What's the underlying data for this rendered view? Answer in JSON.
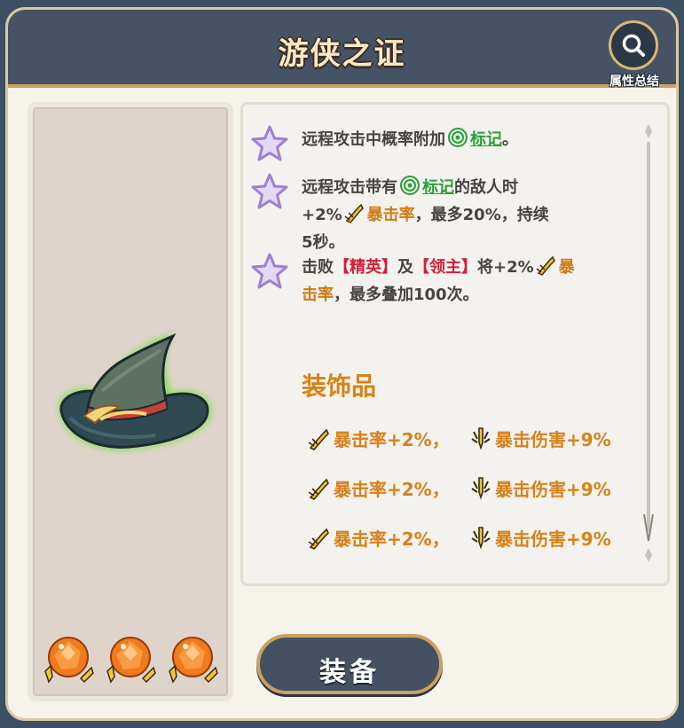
{
  "header": {
    "title": "游侠之证",
    "summary_label": "属性总结"
  },
  "effects": [
    {
      "parts": [
        {
          "t": "远程攻击中概率附加",
          "c": "plain"
        },
        {
          "icon": "target-icon"
        },
        {
          "t": "标记",
          "c": "green"
        },
        {
          "t": "。",
          "c": "plain"
        }
      ]
    },
    {
      "parts": [
        {
          "t": "远程攻击带有",
          "c": "plain"
        },
        {
          "icon": "target-icon"
        },
        {
          "t": "标记",
          "c": "green"
        },
        {
          "t": "的敌人时",
          "c": "plain"
        },
        {
          "br": true
        },
        {
          "t": "+2%",
          "c": "plain"
        },
        {
          "icon": "crit-rate-icon"
        },
        {
          "t": "暴击率",
          "c": "gold"
        },
        {
          "t": "，最多20%，持续",
          "c": "plain"
        },
        {
          "br": true
        },
        {
          "t": "5秒。",
          "c": "plain"
        }
      ]
    },
    {
      "parts": [
        {
          "t": "击败",
          "c": "plain"
        },
        {
          "t": "【精英】",
          "c": "red"
        },
        {
          "t": "及",
          "c": "plain"
        },
        {
          "t": "【领主】",
          "c": "red"
        },
        {
          "t": "将+2%",
          "c": "plain"
        },
        {
          "icon": "crit-rate-icon"
        },
        {
          "t": "暴",
          "c": "gold"
        },
        {
          "br": true
        },
        {
          "t": "击率",
          "c": "gold"
        },
        {
          "t": "，最多叠加100次。",
          "c": "plain"
        }
      ]
    }
  ],
  "accessory": {
    "title": "装饰品",
    "rows": [
      {
        "stat1": "暴击率+2%，",
        "stat2": "暴击伤害+9%"
      },
      {
        "stat1": "暴击率+2%，",
        "stat2": "暴击伤害+9%"
      },
      {
        "stat1": "暴击率+2%，",
        "stat2": "暴击伤害+9%"
      }
    ]
  },
  "orbs": {
    "count": 3,
    "icon": "amber-gem-icon"
  },
  "equip_button": {
    "label": "装备"
  },
  "colors": {
    "header_bg": "#455364",
    "gold_border": "#c9a25f",
    "keyword_gold": "#d07b12",
    "keyword_green": "#2e9c3d",
    "keyword_red": "#d01f3a"
  }
}
